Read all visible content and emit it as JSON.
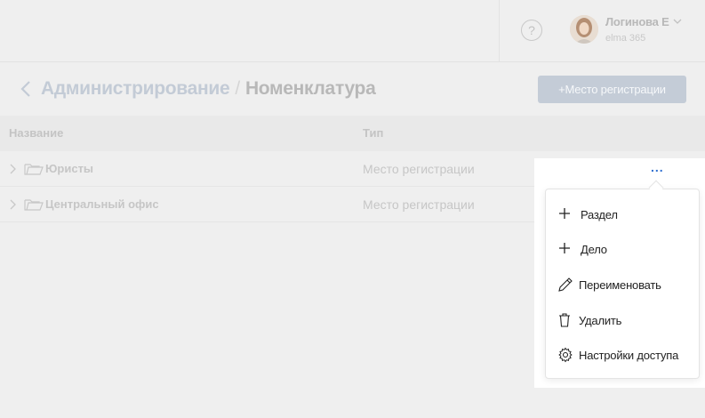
{
  "header": {
    "help_icon": "question-circle-icon",
    "user": {
      "name": "Логинова Е",
      "subtitle": "elma 365"
    }
  },
  "breadcrumb": {
    "parent": "Администрирование",
    "separator": "/",
    "current": "Номенклатура"
  },
  "toolbar": {
    "add_label": "+Место регистрации"
  },
  "table": {
    "columns": [
      "Название",
      "Тип"
    ],
    "rows": [
      {
        "name": "Юристы",
        "type": "Место регистрации"
      },
      {
        "name": "Центральный офис",
        "type": "Место регистрации"
      }
    ]
  },
  "row_actions": {
    "more_label": "...",
    "menu": [
      {
        "label": "Раздел",
        "icon": "plus-icon"
      },
      {
        "label": "Дело",
        "icon": "plus-icon"
      },
      {
        "label": "Переименовать",
        "icon": "pencil-icon"
      },
      {
        "label": "Удалить",
        "icon": "trash-icon"
      },
      {
        "label": "Настройки доступа",
        "icon": "gear-icon"
      }
    ]
  },
  "colors": {
    "accent": "#2f6fd0",
    "muted_link": "#c3cbd6",
    "background": "#efefef"
  }
}
